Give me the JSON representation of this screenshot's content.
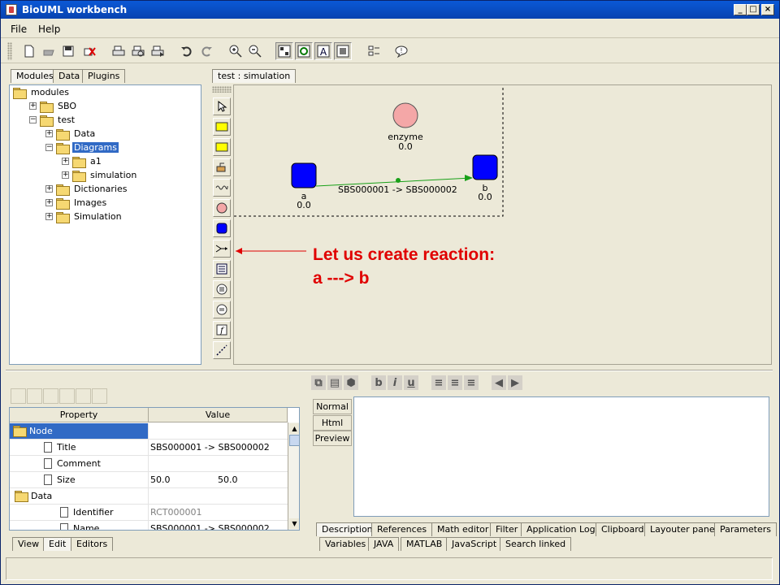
{
  "window": {
    "title": "BioUML workbench"
  },
  "menu": [
    "File",
    "Help"
  ],
  "left_tabs": [
    "Modules",
    "Data",
    "Plugins"
  ],
  "tree": {
    "items": [
      {
        "label": "modules",
        "level": 0,
        "expander": "",
        "open": true
      },
      {
        "label": "SBO",
        "level": 1,
        "expander": "+",
        "open": false
      },
      {
        "label": "test",
        "level": 1,
        "expander": "−",
        "open": true
      },
      {
        "label": "Data",
        "level": 2,
        "expander": "+",
        "open": false
      },
      {
        "label": "Diagrams",
        "level": 2,
        "expander": "−",
        "open": true,
        "selected": true
      },
      {
        "label": "a1",
        "level": 3,
        "expander": "+",
        "open": false
      },
      {
        "label": "simulation",
        "level": 3,
        "expander": "+",
        "open": false
      },
      {
        "label": "Dictionaries",
        "level": 2,
        "expander": "+",
        "open": false
      },
      {
        "label": "Images",
        "level": 2,
        "expander": "+",
        "open": false
      },
      {
        "label": "Simulation",
        "level": 2,
        "expander": "+",
        "open": false
      }
    ]
  },
  "diagram_tab": "test : simulation",
  "diagram": {
    "enzyme": {
      "name": "enzyme",
      "value": "0.0"
    },
    "a": {
      "name": "a",
      "value": "0.0"
    },
    "b": {
      "name": "b",
      "value": "0.0"
    },
    "reaction_label": "SBS000001 -> SBS000002"
  },
  "annotation": {
    "line1": "Let us create reaction:",
    "line2": "a  ---> b"
  },
  "properties": {
    "headers": [
      "Property",
      "Value"
    ],
    "rows": [
      {
        "name": "Node",
        "value": "",
        "selected": true
      },
      {
        "name": "Title",
        "value": "SBS000001 -> SBS000002"
      },
      {
        "name": "Comment",
        "value": ""
      },
      {
        "name": "Size",
        "value": "50.0",
        "value2": "50.0"
      },
      {
        "name": "Data",
        "value": ""
      },
      {
        "name": "Identifier",
        "value": "RCT000001"
      },
      {
        "name": "Name",
        "value": "SBS000001 -> SBS000002"
      }
    ]
  },
  "bottom_left_tabs": [
    "View",
    "Edit",
    "Editors"
  ],
  "editor_side_tabs": [
    "Normal",
    "Html",
    "Preview"
  ],
  "bottom_tabs_row1": [
    "Description",
    "References",
    "Math editor",
    "Filter",
    "Application Log",
    "Clipboard",
    "Layouter pane",
    "Parameters"
  ],
  "bottom_tabs_row2": [
    "Variables",
    "JAVA",
    "MATLAB",
    "JavaScript",
    "Search linked"
  ],
  "colors": {
    "species": "#0000ff",
    "enzyme": "#f4a7a7",
    "reaction_edge": "#18a018",
    "annotation": "#e00000",
    "selection": "#316ac5"
  }
}
